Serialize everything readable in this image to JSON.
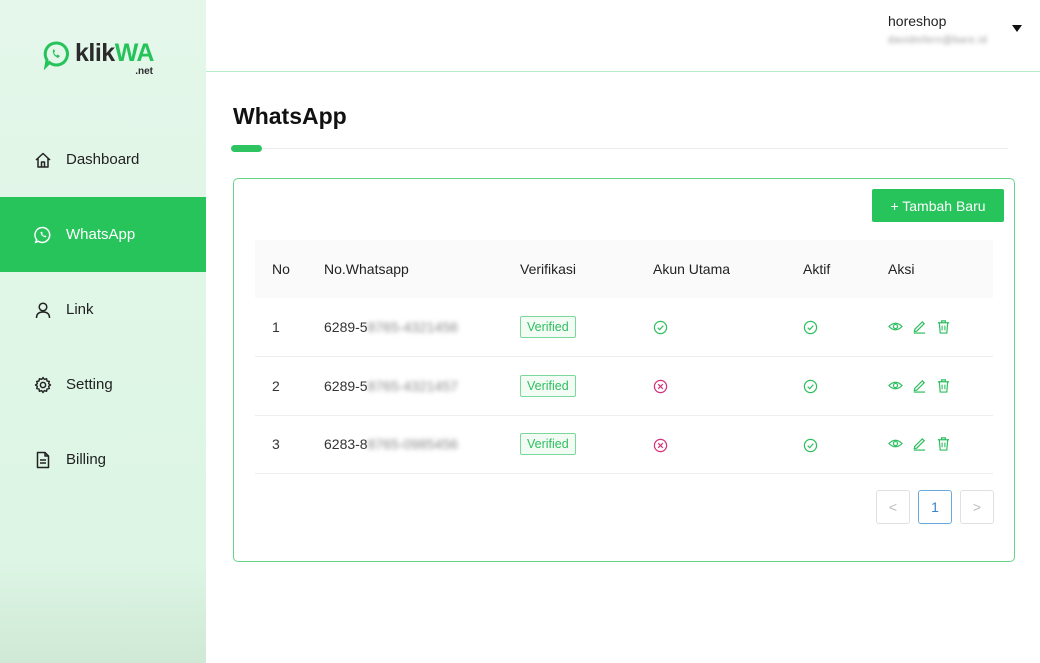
{
  "brand": {
    "name_part1": "klik",
    "name_part2": "WA",
    "suffix": ".net",
    "accent": "#27c35b"
  },
  "sidebar": {
    "items": [
      {
        "label": "Dashboard",
        "icon": "home-icon",
        "active": false
      },
      {
        "label": "WhatsApp",
        "icon": "whatsapp-icon",
        "active": true
      },
      {
        "label": "Link",
        "icon": "user-icon",
        "active": false
      },
      {
        "label": "Setting",
        "icon": "gear-icon",
        "active": false
      },
      {
        "label": "Billing",
        "icon": "document-icon",
        "active": false
      }
    ]
  },
  "header": {
    "user_name": "horeshop",
    "user_email": "davidmfern@bare.id"
  },
  "main": {
    "title": "WhatsApp",
    "add_button": "+ Tambah Baru",
    "table": {
      "columns": [
        "No",
        "No.Whatsapp",
        "Verifikasi",
        "Akun Utama",
        "Aktif",
        "Aksi"
      ],
      "rows": [
        {
          "no": "1",
          "number_prefix": "6289-5",
          "number_hidden": "8765-4321456",
          "verification": "Verified",
          "utama": true,
          "aktif": true
        },
        {
          "no": "2",
          "number_prefix": "6289-5",
          "number_hidden": "8765-4321457",
          "verification": "Verified",
          "utama": false,
          "aktif": true
        },
        {
          "no": "3",
          "number_prefix": "6283-8",
          "number_hidden": "8765-0985456",
          "verification": "Verified",
          "utama": false,
          "aktif": true
        }
      ]
    },
    "pagination": {
      "prev": "<",
      "current": "1",
      "next": ">"
    }
  },
  "colors": {
    "success": "#2fbf60",
    "danger": "#d6307a",
    "pager_active": "#3a84c8"
  }
}
